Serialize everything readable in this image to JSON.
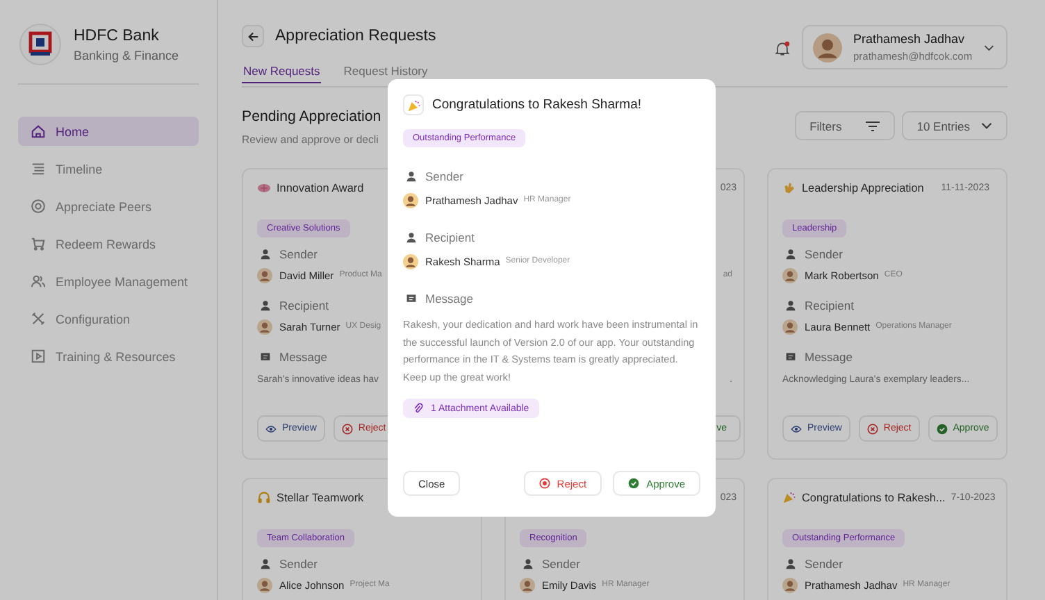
{
  "sidebar": {
    "brand": {
      "name": "HDFC Bank",
      "subtitle": "Banking & Finance"
    },
    "items": [
      {
        "label": "Home",
        "selected": true
      },
      {
        "label": "Timeline",
        "selected": false
      },
      {
        "label": "Appreciate Peers",
        "selected": false
      },
      {
        "label": "Redeem Rewards",
        "selected": false
      },
      {
        "label": "Employee Management",
        "selected": false
      },
      {
        "label": "Configuration",
        "selected": false
      },
      {
        "label": "Training & Resources",
        "selected": false
      }
    ]
  },
  "header": {
    "title": "Appreciation Requests",
    "notification": true,
    "user": {
      "name": "Prathamesh Jadhav",
      "email": "prathamesh@hdfcok.com"
    }
  },
  "tabs": [
    {
      "label": "New Requests",
      "selected": true
    },
    {
      "label": "Request History",
      "selected": false
    }
  ],
  "section": {
    "title": "Pending Appreciation",
    "subtitle": "Review and approve or decli",
    "filters": "Filters",
    "entries": "10 Entries"
  },
  "columns": [
    [
      {
        "title": "Innovation Award",
        "tag": "Creative Solutions",
        "sender": {
          "label": "Sender",
          "name": "David Miller",
          "role": "Product Ma"
        },
        "recipient": {
          "label": "Recipient",
          "name": "Sarah Turner",
          "role": "UX Desig"
        },
        "message": {
          "label": "Message",
          "text": "Sarah's innovative ideas hav"
        },
        "actions": [
          {
            "kind": "preview",
            "label": "Preview",
            "clipped": false
          },
          {
            "kind": "reject",
            "label": "Reject",
            "clipped": false
          }
        ]
      },
      {
        "title": "Stellar Teamwork",
        "tag": "Team Collaboration",
        "sender": {
          "label": "Sender",
          "name": "Alice Johnson",
          "role": "Project Ma"
        }
      }
    ],
    [
      {
        "date": "023",
        "sender": {
          "role": "ad"
        },
        "message": {
          "text": "."
        },
        "actions": [
          {
            "kind": "approve",
            "label": "ve",
            "clipped": true
          }
        ]
      },
      {
        "date": "023",
        "tag": "Recognition",
        "sender": {
          "label": "Sender",
          "name": "Emily Davis",
          "role": "HR Manager"
        }
      }
    ],
    [
      {
        "title": "Leadership Appreciation",
        "date": "11-11-2023",
        "tag": "Leadership",
        "sender": {
          "label": "Sender",
          "name": "Mark Robertson",
          "role": "CEO"
        },
        "recipient": {
          "label": "Recipient",
          "name": "Laura Bennett",
          "role": "Operations Manager"
        },
        "message": {
          "label": "Message",
          "text": "Acknowledging Laura's exemplary leaders..."
        },
        "actions": [
          {
            "kind": "preview",
            "label": "Preview",
            "clipped": false
          },
          {
            "kind": "reject",
            "label": "Reject",
            "clipped": false
          },
          {
            "kind": "approve",
            "label": "Approve",
            "clipped": false
          }
        ]
      },
      {
        "title": "Congratulations to Rakesh...",
        "date": "7-10-2023",
        "tag": "Outstanding Performance",
        "sender": {
          "label": "Sender",
          "name": "Prathamesh Jadhav",
          "role": "HR Manager"
        }
      }
    ]
  ],
  "modal": {
    "title": "Congratulations to Rakesh Sharma!",
    "tag": "Outstanding Performance",
    "sender": {
      "label": "Sender",
      "name": "Prathamesh Jadhav",
      "role": "HR Manager"
    },
    "recipient": {
      "label": "Recipient",
      "name": "Rakesh Sharma",
      "role": "Senior Developer"
    },
    "message": {
      "label": "Message",
      "text": "Rakesh, your dedication and hard work have been instrumental in the successful launch of Version 2.0 of our app. Your outstanding performance in the IT & Systems team is greatly appreciated. Keep up the great work!"
    },
    "attachment": "1 Attachment Available",
    "buttons": [
      {
        "kind": "close",
        "label": "Close"
      },
      {
        "kind": "reject",
        "label": "Reject"
      },
      {
        "kind": "approve",
        "label": "Approve"
      }
    ]
  }
}
